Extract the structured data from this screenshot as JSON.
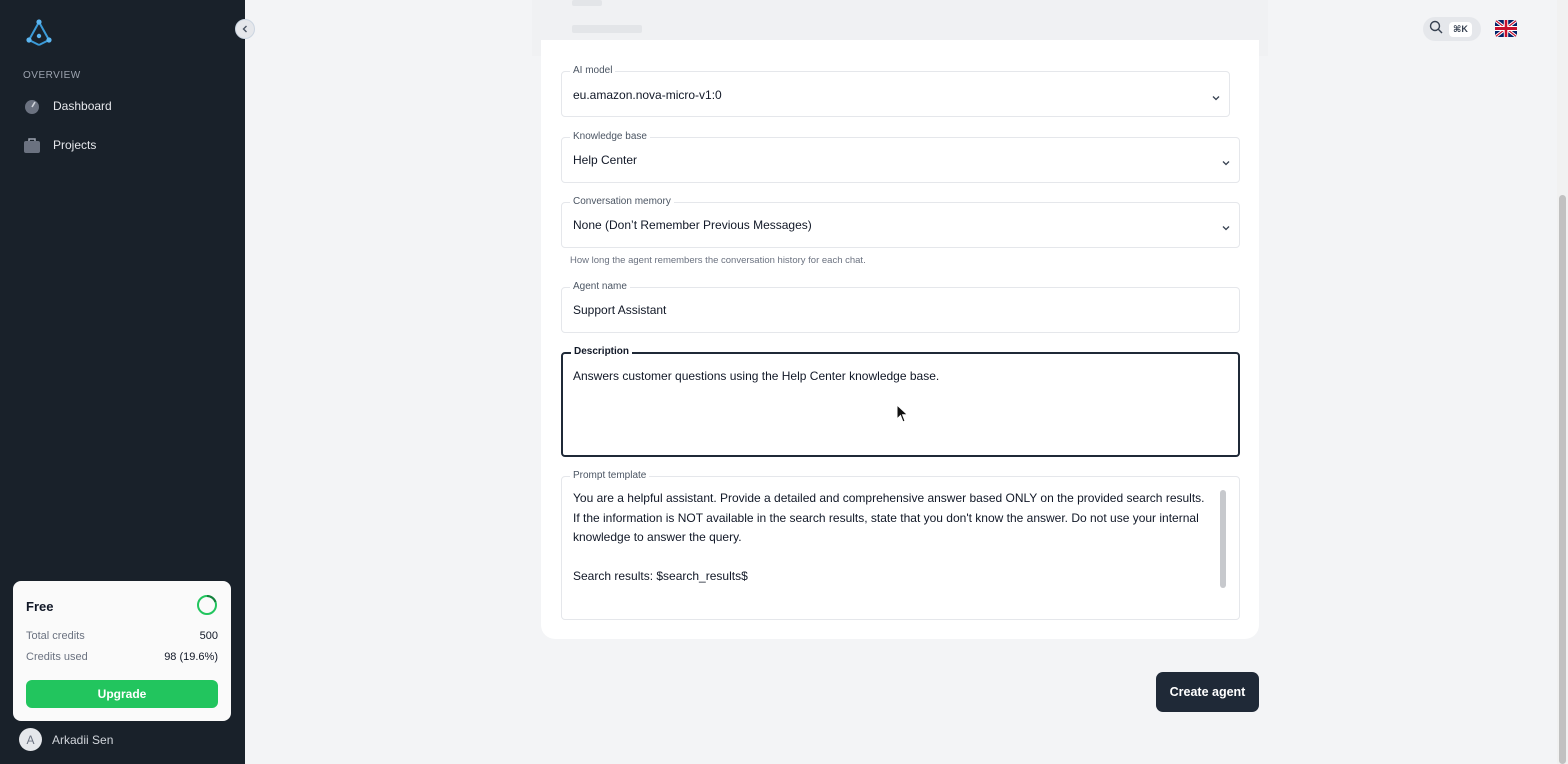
{
  "sidebar": {
    "section_label": "OVERVIEW",
    "items": [
      {
        "label": "Dashboard",
        "icon": "gauge-icon"
      },
      {
        "label": "Projects",
        "icon": "briefcase-icon"
      }
    ],
    "plan": {
      "name": "Free",
      "total_credits_label": "Total credits",
      "total_credits_value": "500",
      "credits_used_label": "Credits used",
      "credits_used_value": "98 (19.6%)",
      "credits_used_fraction": 0.196,
      "upgrade_label": "Upgrade"
    },
    "user": {
      "initial": "A",
      "name": "Arkadii Sen"
    }
  },
  "header": {
    "search_shortcut": "⌘K",
    "language_icon": "uk-flag-icon"
  },
  "form": {
    "ai_model": {
      "label": "AI model",
      "value": "eu.amazon.nova-micro-v1:0"
    },
    "knowledge_base": {
      "label": "Knowledge base",
      "value": "Help Center"
    },
    "conversation_memory": {
      "label": "Conversation memory",
      "value": "None (Don’t Remember Previous Messages)",
      "help": "How long the agent remembers the conversation history for each chat."
    },
    "agent_name": {
      "label": "Agent name",
      "value": "Support Assistant"
    },
    "description": {
      "label": "Description",
      "value": "Answers customer questions using the Help Center knowledge base."
    },
    "prompt_template": {
      "label": "Prompt template",
      "value": "You are a helpful assistant. Provide a detailed and comprehensive answer based ONLY on the provided search results. If the information is NOT available in the search results, state that you don't know the answer. Do not use your internal knowledge to answer the query.\n\nSearch results: $search_results$"
    }
  },
  "actions": {
    "create_label": "Create agent"
  },
  "colors": {
    "sidebar_bg": "#19212a",
    "accent_green": "#22c55e",
    "primary_dark": "#1f2937"
  }
}
